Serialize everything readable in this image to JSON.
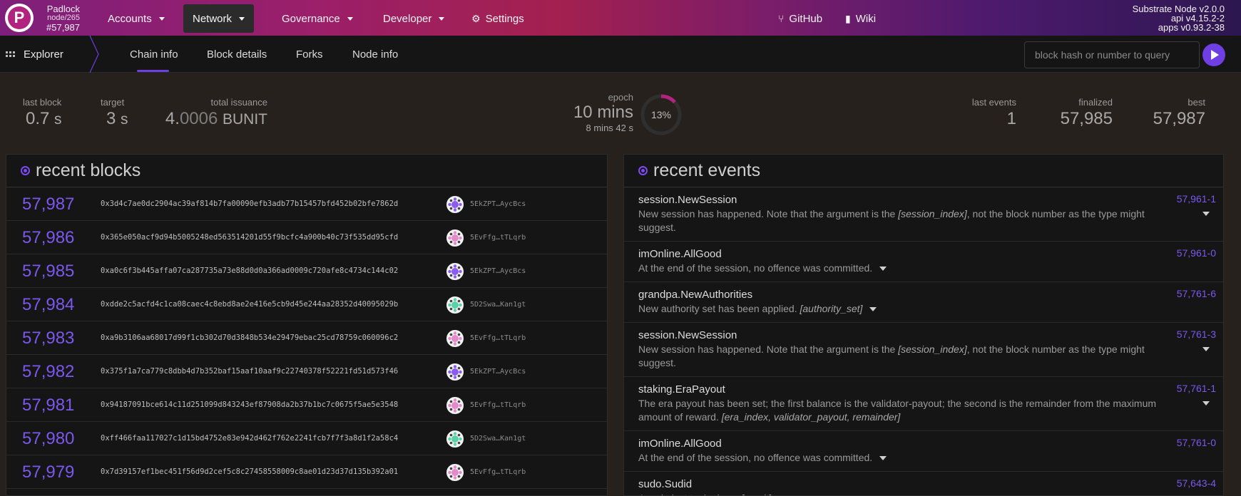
{
  "chain": {
    "name": "Padlock",
    "node": "node/265",
    "block": "#57,987"
  },
  "nav": {
    "accounts": "Accounts",
    "network": "Network",
    "governance": "Governance",
    "developer": "Developer",
    "settings": "Settings",
    "github": "GitHub",
    "wiki": "Wiki"
  },
  "versions": {
    "node": "Substrate Node v2.0.0",
    "api": "api v4.15.2-2",
    "apps": "apps v0.93.2-38"
  },
  "subnav": {
    "section": "Explorer",
    "tabs": [
      "Chain info",
      "Block details",
      "Forks",
      "Node info"
    ],
    "active_tab": "Chain info",
    "query_placeholder": "block hash or number to query"
  },
  "summary": {
    "last_block": {
      "label": "last block",
      "value": "0.7",
      "unit": "s"
    },
    "target": {
      "label": "target",
      "value": "3",
      "unit": "s"
    },
    "total_issuance": {
      "label": "total issuance",
      "value_main": "4.",
      "value_dim": "0006",
      "unit": "BUNIT"
    },
    "epoch": {
      "label": "epoch",
      "value": "10 mins",
      "sub": "8 mins 42 s",
      "percent_label": "13%",
      "progress": 0.13
    },
    "last_events": {
      "label": "last events",
      "value": "1"
    },
    "finalized": {
      "label": "finalized",
      "value": "57,985"
    },
    "best": {
      "label": "best",
      "value": "57,987"
    }
  },
  "recent_blocks": {
    "title": "recent blocks",
    "rows": [
      {
        "number": "57,987",
        "hash": "0x3d4c7ae0dc2904ac39af814b7fa00090efb3adb77b15457bfd452b02bfe7862d",
        "author": "5EkZPT…AycBcs",
        "avatar": "#8a5cf0"
      },
      {
        "number": "57,986",
        "hash": "0x365e050acf9d94b5005248ed563514201d55f9bcfc4a900b40c73f535dd95cfd",
        "author": "5EvFfg…tTLqrb",
        "avatar": "#e58ac9"
      },
      {
        "number": "57,985",
        "hash": "0xa0c6f3b445affa07ca287735a73e88d0d0a366ad0009c720afe8c4734c144c02",
        "author": "5EkZPT…AycBcs",
        "avatar": "#8a5cf0"
      },
      {
        "number": "57,984",
        "hash": "0xdde2c5acfd4c1ca08caec4c8ebd8ae2e416e5cb9d45e244aa28352d40095029b",
        "author": "5D2Swa…Kan1gt",
        "avatar": "#5ad1a7"
      },
      {
        "number": "57,983",
        "hash": "0xa9b3106aa68017d99f1cb302d70d3848b534e29479ebac25cd78759c060096c2",
        "author": "5EvFfg…tTLqrb",
        "avatar": "#e58ac9"
      },
      {
        "number": "57,982",
        "hash": "0x375f1a7ca779c8dbb4d7b352baf15aaf10aaf9c22740378f52221fd51d573f46",
        "author": "5EkZPT…AycBcs",
        "avatar": "#8a5cf0"
      },
      {
        "number": "57,981",
        "hash": "0x94187091bce614c11d251099d843243ef87908da2b37b1bc7c0675f5ae5e3548",
        "author": "5EvFfg…tTLqrb",
        "avatar": "#e58ac9"
      },
      {
        "number": "57,980",
        "hash": "0xff466faa117027c1d15bd4752e83e942d462f762e2241fcb7f7f3a8d1f2a58c4",
        "author": "5D2Swa…Kan1gt",
        "avatar": "#5ad1a7"
      },
      {
        "number": "57,979",
        "hash": "0x7d39157ef1bec451f56d9d2cef5c8c27458558009c8ae01d23d37d135b392a01",
        "author": "5EvFfg…tTLqrb",
        "avatar": "#e58ac9"
      }
    ]
  },
  "recent_events": {
    "title": "recent events",
    "rows": [
      {
        "name": "session.NewSession",
        "desc": "New session has happened. Note that the argument is the ",
        "arg": "[session_index]",
        "tail": ", not the block number as the type might suggest.",
        "ref": "57,961-1",
        "wrap": true
      },
      {
        "name": "imOnline.AllGood",
        "desc": "At the end of the session, no offence was committed.",
        "arg": "",
        "tail": "",
        "ref": "57,961-0",
        "wrap": false
      },
      {
        "name": "grandpa.NewAuthorities",
        "desc": "New authority set has been applied. ",
        "arg": "[authority_set]",
        "tail": "",
        "ref": "57,761-6",
        "wrap": false
      },
      {
        "name": "session.NewSession",
        "desc": "New session has happened. Note that the argument is the ",
        "arg": "[session_index]",
        "tail": ", not the block number as the type might suggest.",
        "ref": "57,761-3",
        "wrap": true
      },
      {
        "name": "staking.EraPayout",
        "desc": "The era payout has been set; the first balance is the validator-payout; the second is the remainder from the maximum amount of reward. ",
        "arg": "[era_index, validator_payout, remainder]",
        "tail": "",
        "ref": "57,761-1",
        "wrap": true
      },
      {
        "name": "imOnline.AllGood",
        "desc": "At the end of the session, no offence was committed.",
        "arg": "",
        "tail": "",
        "ref": "57,761-0",
        "wrap": false
      },
      {
        "name": "sudo.Sudid",
        "desc": "A sudo just took place. ",
        "arg": "[result]",
        "tail": "",
        "ref": "57,643-4",
        "wrap": false
      }
    ]
  },
  "colors": {
    "accent": "#7b58ee",
    "brand": "#b1237f"
  }
}
